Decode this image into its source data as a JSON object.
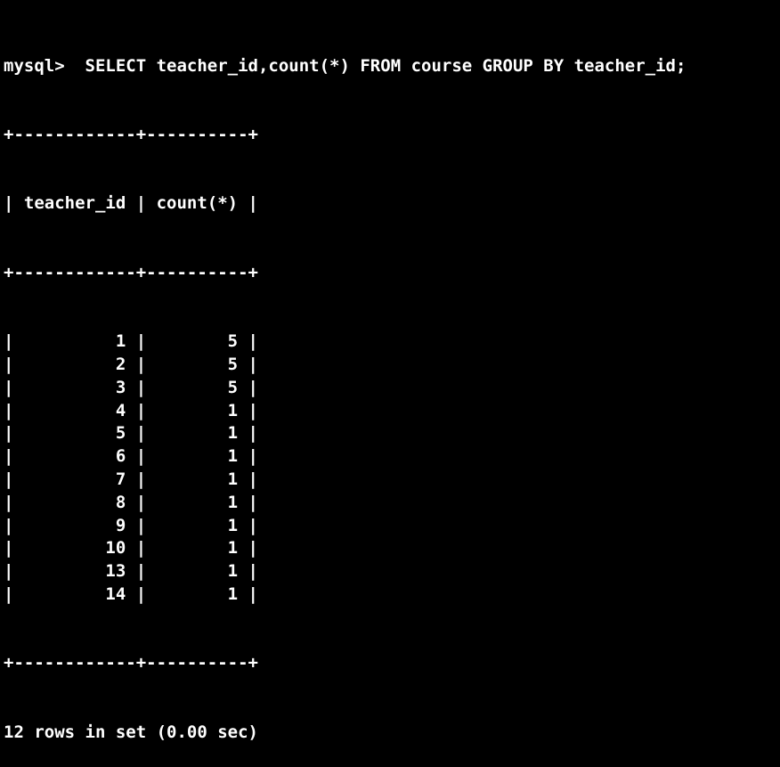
{
  "terminal": {
    "prompt": "mysql>",
    "query": "  SELECT teacher_id,count(*) FROM course GROUP BY teacher_id;",
    "border": "+------------+----------+",
    "header_line": "| teacher_id | count(*) |",
    "columns": [
      "teacher_id",
      "count(*)"
    ],
    "rows": [
      {
        "teacher_id": "1",
        "count": "5"
      },
      {
        "teacher_id": "2",
        "count": "5"
      },
      {
        "teacher_id": "3",
        "count": "5"
      },
      {
        "teacher_id": "4",
        "count": "1"
      },
      {
        "teacher_id": "5",
        "count": "1"
      },
      {
        "teacher_id": "6",
        "count": "1"
      },
      {
        "teacher_id": "7",
        "count": "1"
      },
      {
        "teacher_id": "8",
        "count": "1"
      },
      {
        "teacher_id": "9",
        "count": "1"
      },
      {
        "teacher_id": "10",
        "count": "1"
      },
      {
        "teacher_id": "13",
        "count": "1"
      },
      {
        "teacher_id": "14",
        "count": "1"
      }
    ],
    "footer": "12 rows in set (0.00 sec)"
  },
  "colors": {
    "background": "#000000",
    "text": "#ffffff"
  }
}
